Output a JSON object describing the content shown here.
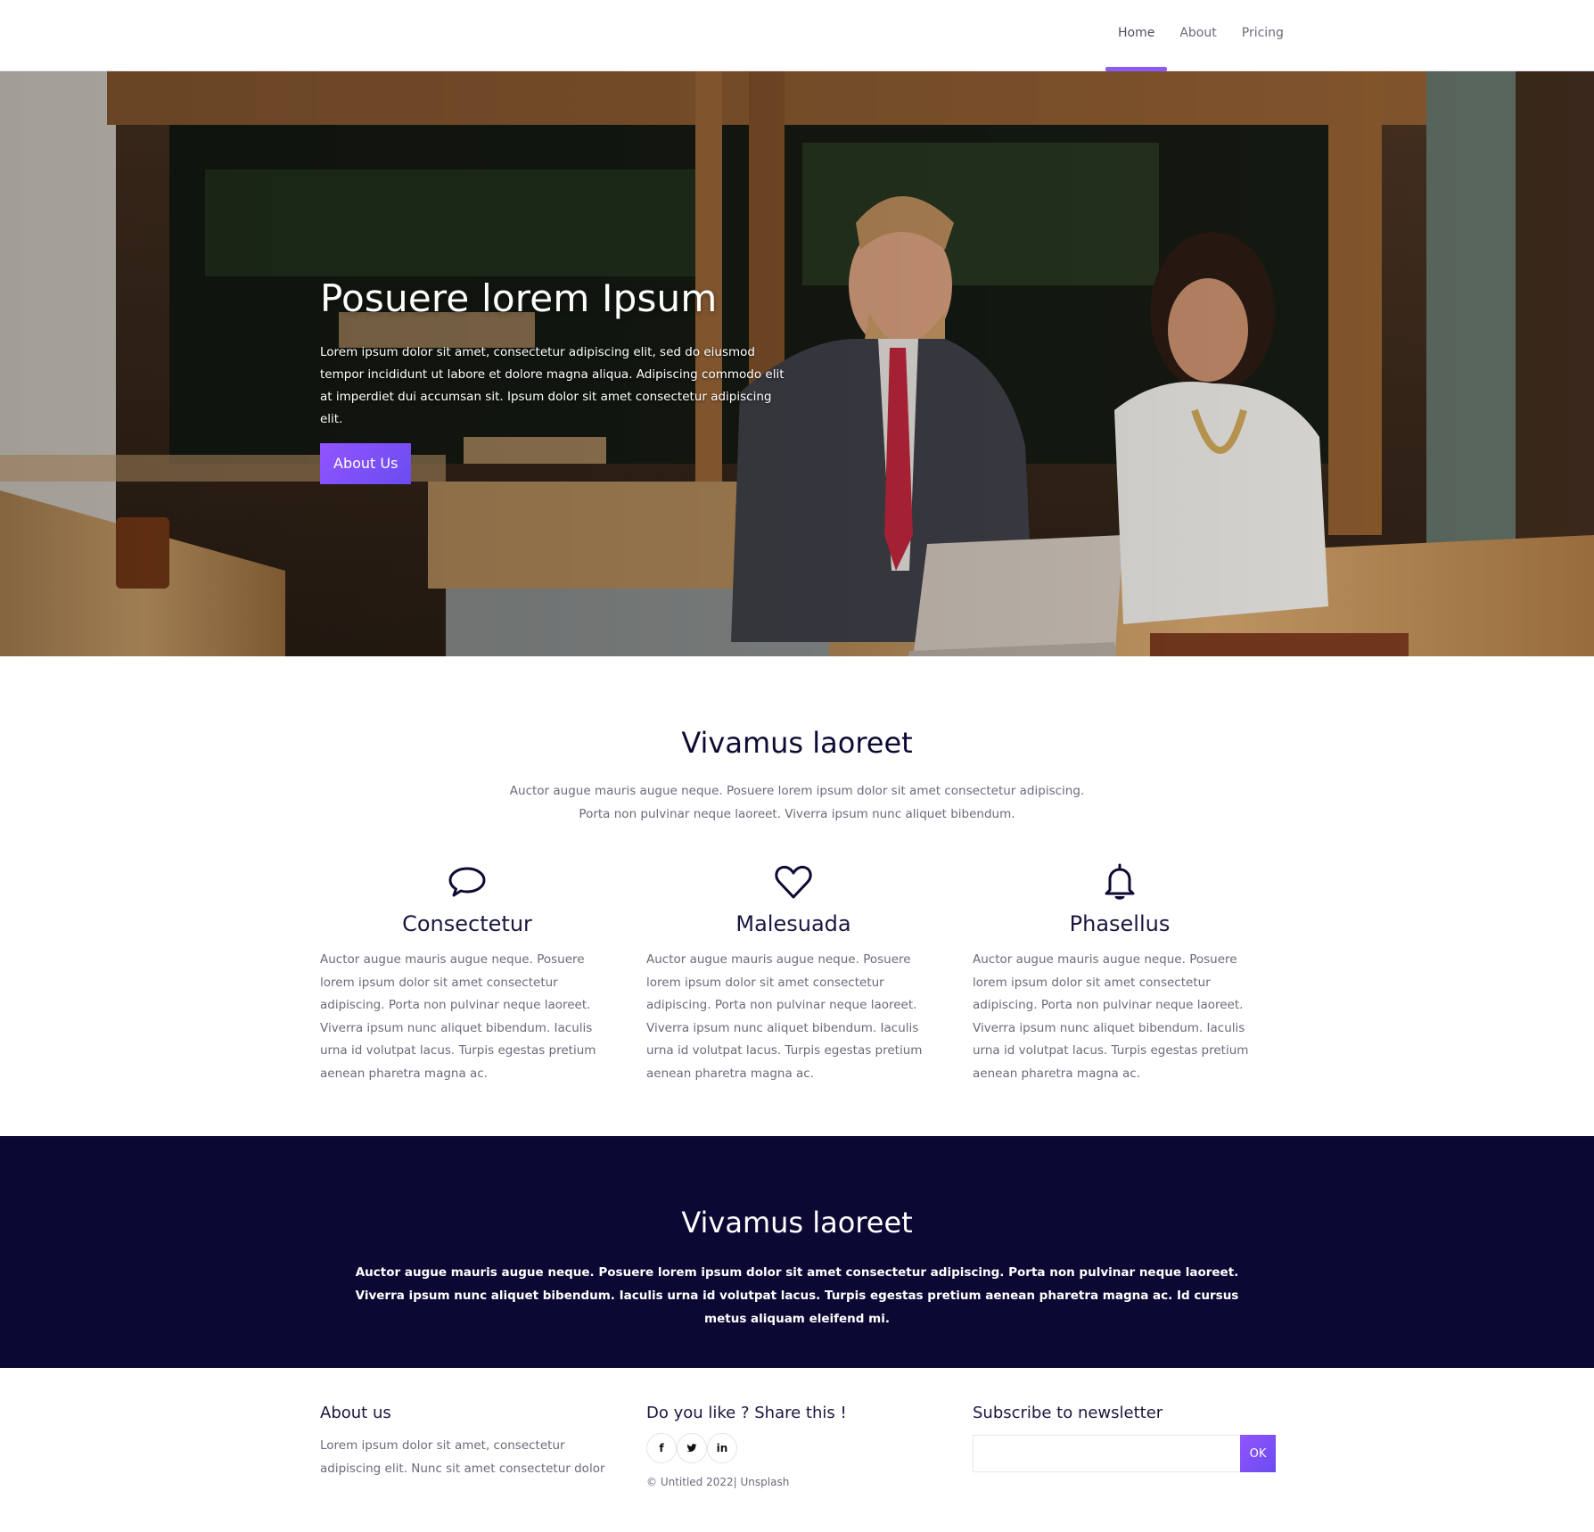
{
  "nav": {
    "items": [
      {
        "label": "Home",
        "active": true
      },
      {
        "label": "About",
        "active": false
      },
      {
        "label": "Pricing",
        "active": false
      }
    ],
    "accent_color": "#8a5cf5"
  },
  "hero": {
    "title": "Posuere lorem Ipsum",
    "text": "Lorem ipsum dolor sit amet, consectetur adipiscing elit, sed do eiusmod tempor incididunt ut labore et dolore magna aliqua. Adipiscing commodo elit at imperdiet dui accumsan sit. Ipsum dolor sit amet consectetur adipiscing elit.",
    "button_label": "About Us"
  },
  "features": {
    "title": "Vivamus laoreet",
    "subtitle_line1": "Auctor augue mauris augue neque. Posuere lorem ipsum dolor sit amet consectetur adipiscing.",
    "subtitle_line2": "Porta non pulvinar neque laoreet. Viverra ipsum nunc aliquet bibendum.",
    "items": [
      {
        "icon": "chat-bubble-icon",
        "title": "Consectetur",
        "text": "Auctor augue mauris augue neque. Posuere lorem ipsum dolor sit amet consectetur adipiscing. Porta non pulvinar neque laoreet. Viverra ipsum nunc aliquet bibendum. Iaculis urna id volutpat lacus. Turpis egestas pretium aenean pharetra magna ac."
      },
      {
        "icon": "heart-icon",
        "title": "Malesuada",
        "text": "Auctor augue mauris augue neque. Posuere lorem ipsum dolor sit amet consectetur adipiscing. Porta non pulvinar neque laoreet. Viverra ipsum nunc aliquet bibendum. Iaculis urna id volutpat lacus. Turpis egestas pretium aenean pharetra magna ac."
      },
      {
        "icon": "bell-icon",
        "title": "Phasellus",
        "text": "Auctor augue mauris augue neque. Posuere lorem ipsum dolor sit amet consectetur adipiscing. Porta non pulvinar neque laoreet. Viverra ipsum nunc aliquet bibendum. Iaculis urna id volutpat lacus. Turpis egestas pretium aenean pharetra magna ac."
      }
    ]
  },
  "band": {
    "title": "Vivamus laoreet",
    "text": "Auctor augue mauris augue neque. Posuere lorem ipsum dolor sit amet consectetur adipiscing. Porta non pulvinar neque laoreet. Viverra ipsum nunc aliquet bibendum. Iaculis urna id volutpat lacus. Turpis egestas pretium aenean pharetra magna ac. Id cursus metus aliquam eleifend mi.",
    "background_color": "#0c0834"
  },
  "footer": {
    "about": {
      "heading": "About us",
      "text": "Lorem ipsum dolor sit amet, consectetur adipiscing elit. Nunc sit amet consectetur dolor"
    },
    "share": {
      "heading": "Do you like ? Share this !",
      "social": [
        {
          "icon": "facebook-icon",
          "glyph": "f"
        },
        {
          "icon": "twitter-icon",
          "glyph": "t"
        },
        {
          "icon": "linkedin-icon",
          "glyph": "in"
        }
      ],
      "copyright": "© Untitled 2022| Unsplash"
    },
    "newsletter": {
      "heading": "Subscribe to newsletter",
      "input_value": "",
      "button_label": "OK"
    }
  }
}
